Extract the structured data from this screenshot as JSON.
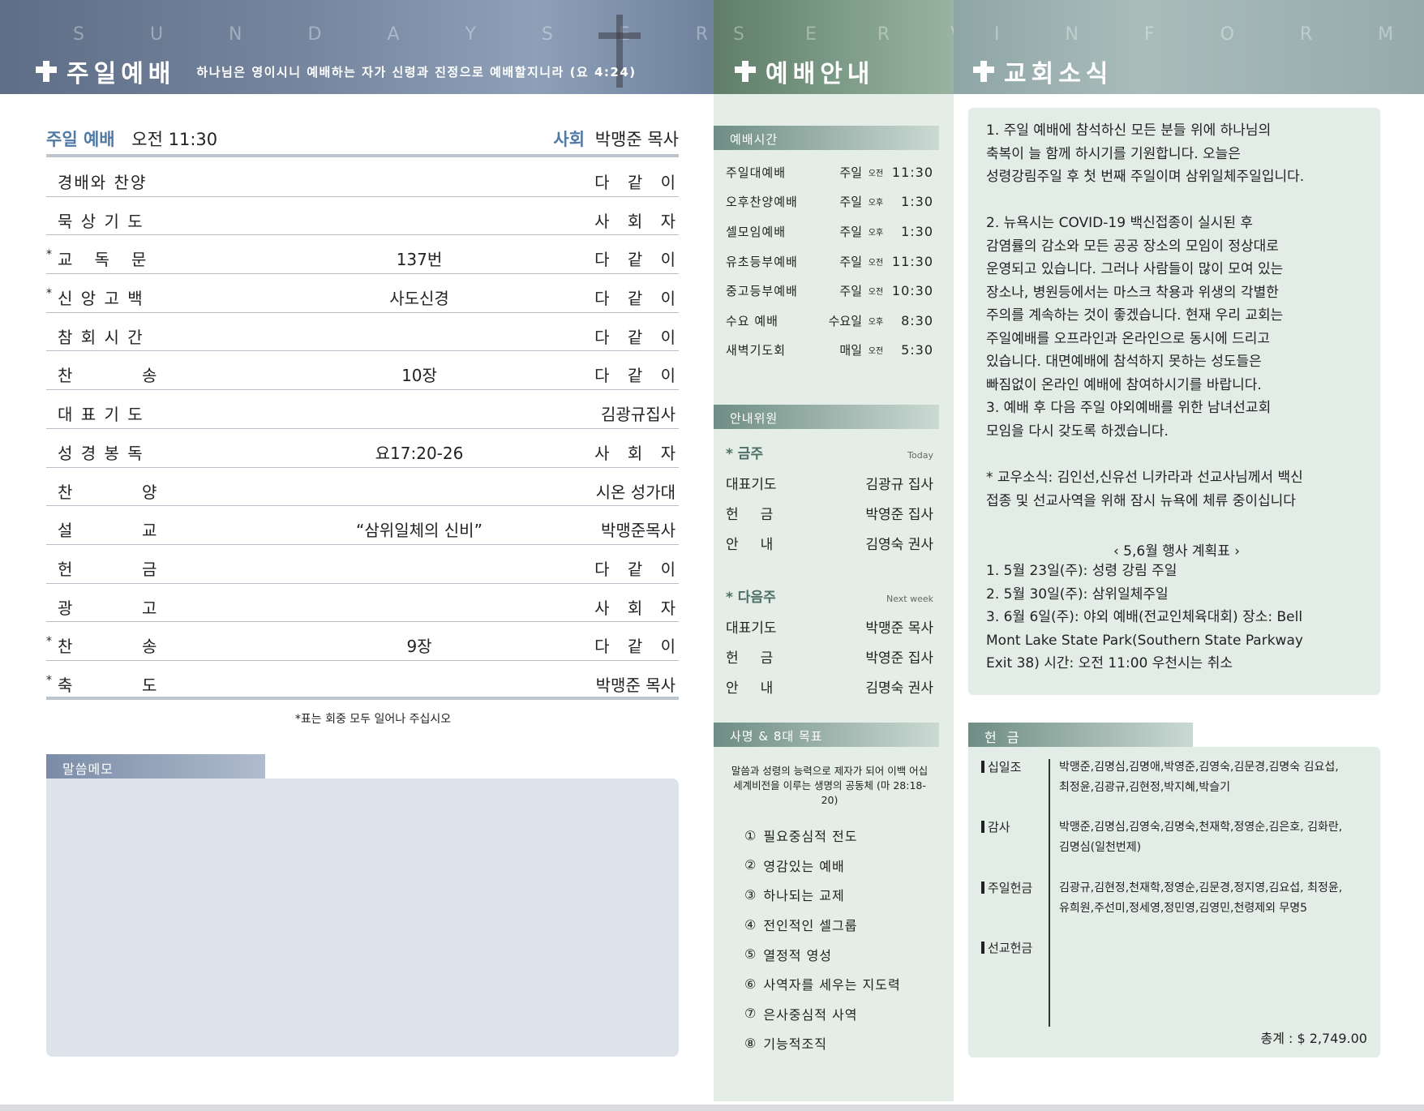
{
  "headers": {
    "left": {
      "ghost": "S U N D A Y   S E R V I C E",
      "title": "주일예배",
      "verse": "하나님은 영이시니 예배하는 자가 신령과 진정으로 예배할지니라 (요 4:24)"
    },
    "middle": {
      "ghost": "S E R V I C E",
      "title": "예배안내"
    },
    "right": {
      "ghost": "I N F O R M A T I O N",
      "title": "교회소식"
    }
  },
  "service": {
    "label": "주일 예배",
    "time": "오전 11:30",
    "presider_label": "사회",
    "presider": "박맹준 목사",
    "order": [
      {
        "star": "",
        "name": "경배와 찬양",
        "mid": "",
        "who": "다 같 이"
      },
      {
        "star": "",
        "name": "묵 상 기 도",
        "mid": "",
        "who": "사 회 자"
      },
      {
        "star": "*",
        "name": "교   독   문",
        "mid": "137번",
        "who": "다 같 이"
      },
      {
        "star": "*",
        "name": "신 앙 고 백",
        "mid": "사도신경",
        "who": "다 같 이"
      },
      {
        "star": "",
        "name": "참 회 시 간",
        "mid": "",
        "who": "다 같 이"
      },
      {
        "star": "",
        "name": "찬          송",
        "mid": "10장",
        "who": "다 같 이"
      },
      {
        "star": "",
        "name": "대 표 기 도",
        "mid": "",
        "who": "김광규집사"
      },
      {
        "star": "",
        "name": "성 경 봉 독",
        "mid": "요17:20-26",
        "who": "사 회 자"
      },
      {
        "star": "",
        "name": "찬          양",
        "mid": "",
        "who": "시온 성가대"
      },
      {
        "star": "",
        "name": "설          교",
        "mid": "“삼위일체의 신비”",
        "who": "박맹준목사"
      },
      {
        "star": "",
        "name": "헌          금",
        "mid": "",
        "who": "다 같 이"
      },
      {
        "star": "",
        "name": "광          고",
        "mid": "",
        "who": "사 회 자"
      },
      {
        "star": "*",
        "name": "찬          송",
        "mid": "9장",
        "who": "다 같 이"
      },
      {
        "star": "*",
        "name": "축          도",
        "mid": "",
        "who": "박맹준 목사"
      }
    ],
    "note": "*표는 회중 모두 일어나 주십시오"
  },
  "memo": {
    "label": "말씀메모"
  },
  "times": {
    "label": "예배시간",
    "rows": [
      {
        "name": "주일대예배",
        "day": "주일",
        "ampm": "오전",
        "time": "11:30"
      },
      {
        "name": "오후찬양예배",
        "day": "주일",
        "ampm": "오후",
        "time": "1:30"
      },
      {
        "name": "셀모임예배",
        "day": "주일",
        "ampm": "오후",
        "time": "1:30"
      },
      {
        "name": "유초등부예배",
        "day": "주일",
        "ampm": "오전",
        "time": "11:30"
      },
      {
        "name": "중고등부예배",
        "day": "주일",
        "ampm": "오전",
        "time": "10:30"
      },
      {
        "name": "수요 예배",
        "day": "수요일",
        "ampm": "오후",
        "time": "8:30"
      },
      {
        "name": "새벽기도회",
        "day": "매일",
        "ampm": "오전",
        "time": "5:30"
      }
    ]
  },
  "ushers": {
    "label": "안내위원",
    "this_week": {
      "title": "* 금주",
      "en": "Today",
      "rows": [
        {
          "role": "대표기도",
          "name": "김광규 집사"
        },
        {
          "role": "헌     금",
          "name": "박영준 집사"
        },
        {
          "role": "안     내",
          "name": "김영숙 권사"
        }
      ]
    },
    "next_week": {
      "title": "* 다음주",
      "en": "Next week",
      "rows": [
        {
          "role": "대표기도",
          "name": "박맹준 목사"
        },
        {
          "role": "헌     금",
          "name": "박영준 집사"
        },
        {
          "role": "안     내",
          "name": "김명숙 권사"
        }
      ]
    }
  },
  "mission": {
    "label": "사명 & 8대 목표",
    "intro": "말씀과 성령의 능력으로 제자가 되어 이백 어십 세계비전을 이루는 생명의 공동체 (마 28:18-20)",
    "goals": [
      {
        "num": "①",
        "text": "필요중심적 전도"
      },
      {
        "num": "②",
        "text": "영감있는 예배"
      },
      {
        "num": "③",
        "text": "하나되는 교제"
      },
      {
        "num": "④",
        "text": "전인적인 셀그룹"
      },
      {
        "num": "⑤",
        "text": "열정적 영성"
      },
      {
        "num": "⑥",
        "text": "사역자를 세우는 지도력"
      },
      {
        "num": "⑦",
        "text": "은사중심적 사역"
      },
      {
        "num": "⑧",
        "text": "기능적조직"
      }
    ]
  },
  "news": {
    "p1": "1. 주일 예배에 참석하신 모든 분들 위에 하나님의\n축복이 늘 함께 하시기를 기원합니다. 오늘은\n성령강림주일 후 첫 번째 주일이며 삼위일체주일입니다.",
    "p2": "2. 뉴욕시는 COVID-19 백신접종이 실시된 후\n감염률의 감소와 모든 공공 장소의 모임이 정상대로\n운영되고 있습니다. 그러나 사람들이 많이 모여 있는\n장소나, 병원등에서는 마스크 착용과 위생의 각별한\n주의를 계속하는 것이 좋겠습니다. 현재 우리 교회는\n주일예배를 오프라인과 온라인으로 동시에 드리고\n있습니다. 대면예배에 참석하지 못하는 성도들은\n빠짐없이 온라인 예배에 참여하시기를 바랍니다.\n3. 예배 후  다음 주일 야외예배를 위한 남녀선교회\n모임을 다시 갖도록 하겠습니다.",
    "p3": "* 교우소식: 김인선,신유선 니카라과 선교사님께서 백신\n접종 및 선교사역을 위해 잠시 뉴욕에 체류 중이십니다",
    "plan_title": "‹  5,6월 행사 계획표  ›",
    "plan": "1. 5월 23일(주): 성령 강림 주일\n2. 5월 30일(주): 삼위일체주일\n3. 6월   6일(주): 야외 예배(전교인체육대회) 장소: Bell\n    Mont Lake State Park(Southern State Parkway\n    Exit 38) 시간: 오전 11:00 우천시는 취소"
  },
  "offering": {
    "label": "헌 금",
    "categories": [
      {
        "name": "십일조",
        "names": "박맹준,김명심,김명애,박영준,김영숙,김문경,김명숙 김요섭,최정윤,김광규,김현정,박지혜,박슬기"
      },
      {
        "name": "감사",
        "names": "박맹준,김명심,김영숙,김명숙,천재학,정영순,김은호, 김화란,김명심(일천번제)"
      },
      {
        "name": "주일헌금",
        "names": "김광규,김현정,천재학,정영순,김문경,정지영,김요섭, 최정윤,유희원,주선미,정세영,정민영,김영민,천령제외 무명5"
      },
      {
        "name": "선교헌금",
        "names": ""
      }
    ],
    "total": "총계 : $ 2,749.00"
  }
}
